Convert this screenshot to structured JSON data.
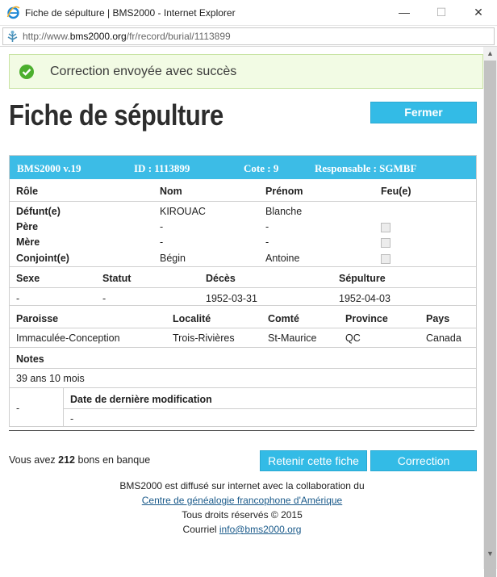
{
  "window": {
    "title": "Fiche de sépulture | BMS2000 - Internet Explorer",
    "minimize": "—",
    "maximize": "☐",
    "close": "✕",
    "url_prefix": "http://www.",
    "url_domain": "bms2000.org",
    "url_path": "/fr/record/burial/1113899"
  },
  "alert": {
    "text": "Correction envoyée avec succès"
  },
  "page": {
    "title": "Fiche de sépulture",
    "close_label": "Fermer"
  },
  "record": {
    "header": {
      "version": "BMS2000 v.19",
      "id": "ID : 1113899",
      "cote": "Cote : 9",
      "responsable": "Responsable : SGMBF"
    },
    "persons_headers": {
      "role": "Rôle",
      "nom": "Nom",
      "prenom": "Prénom",
      "feu": "Feu(e)"
    },
    "persons": [
      {
        "role": "Défunt(e)",
        "nom": "KIROUAC",
        "prenom": "Blanche"
      },
      {
        "role": "Père",
        "nom": "-",
        "prenom": "-"
      },
      {
        "role": "Mère",
        "nom": "-",
        "prenom": "-"
      },
      {
        "role": "Conjoint(e)",
        "nom": "Bégin",
        "prenom": "Antoine"
      }
    ],
    "vitals_headers": {
      "sexe": "Sexe",
      "statut": "Statut",
      "deces": "Décès",
      "sepulture": "Sépulture"
    },
    "vitals": {
      "sexe": "-",
      "statut": "-",
      "deces": "1952-03-31",
      "sepulture": "1952-04-03"
    },
    "place_headers": {
      "paroisse": "Paroisse",
      "localite": "Localité",
      "comte": "Comté",
      "province": "Province",
      "pays": "Pays"
    },
    "place": {
      "paroisse": "Immaculée-Conception",
      "localite": "Trois-Rivières",
      "comte": "St-Maurice",
      "province": "QC",
      "pays": "Canada"
    },
    "notes_label": "Notes",
    "notes": "39 ans 10 mois",
    "last_mod_label": "Date de dernière modification",
    "last_mod_left": "-",
    "last_mod_value": "-"
  },
  "footer": {
    "bank_prefix": "Vous avez ",
    "bank_count": "212",
    "bank_suffix": " bons en banque",
    "retain_label": "Retenir cette fiche",
    "correction_label": "Correction",
    "line1": "BMS2000 est diffusé sur internet avec la collaboration du",
    "link": "Centre de généalogie francophone d'Amérique",
    "rights": "Tous droits réservés © 2015",
    "contact_label": "Courriel ",
    "email": "info@bms2000.org"
  },
  "colors": {
    "accent": "#33bbe6",
    "success_bg": "#f2fbe4",
    "success_icon": "#4caf2e"
  }
}
